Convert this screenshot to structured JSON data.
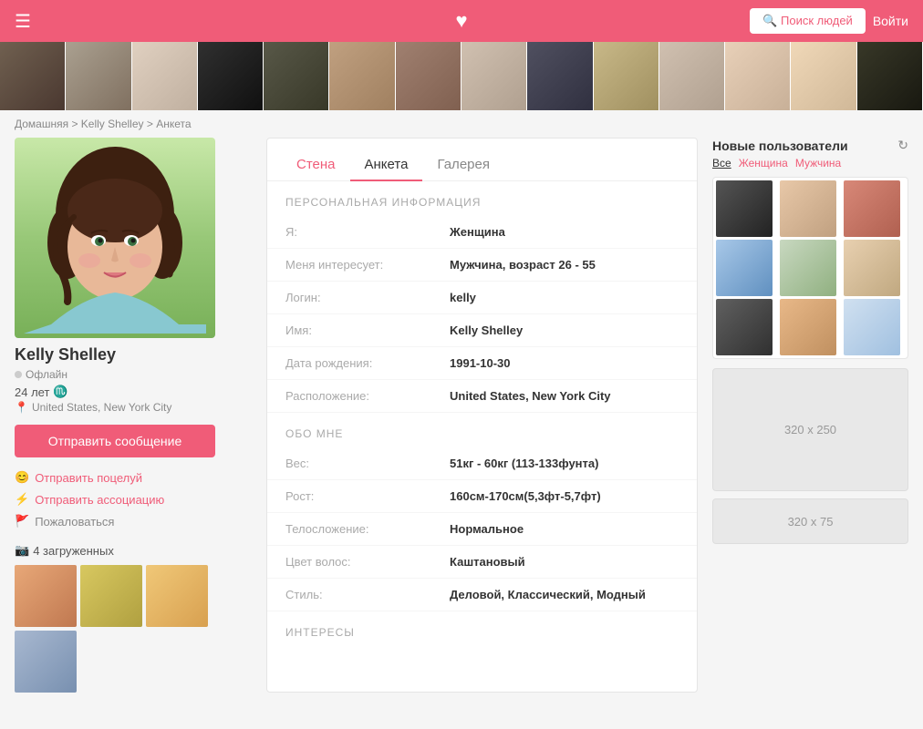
{
  "header": {
    "search_btn": "🔍 Поиск людей",
    "login_btn": "Войти",
    "heart": "♥"
  },
  "breadcrumb": {
    "home": "Домашняя",
    "name": "Kelly Shelley",
    "page": "Анкета"
  },
  "profile": {
    "name": "Kelly Shelley",
    "status": "Офлайн",
    "age": "24 лет",
    "zodiac": "♏",
    "location": "United States, New York City",
    "send_msg": "Отправить сообщение",
    "actions": [
      {
        "label": "Отправить поцелуй",
        "icon": "😊",
        "pink": true
      },
      {
        "label": "Отправить ассоциацию",
        "icon": "⚡",
        "pink": true
      },
      {
        "label": "Пожаловаться",
        "icon": "🚩",
        "pink": false
      }
    ],
    "photos_label": "4 загруженных",
    "camera_icon": "📷"
  },
  "tabs": [
    {
      "label": "Стена",
      "id": "wall",
      "active": false,
      "pink": true
    },
    {
      "label": "Анкета",
      "id": "profile",
      "active": true,
      "pink": false
    },
    {
      "label": "Галерея",
      "id": "gallery",
      "active": false,
      "pink": false
    }
  ],
  "personal_info": {
    "section_title": "ПЕРСОНАЛЬНАЯ ИНФОРМАЦИЯ",
    "fields": [
      {
        "label": "Я:",
        "value": "Женщина"
      },
      {
        "label": "Меня интересует:",
        "value": "Мужчина, возраст 26 - 55"
      },
      {
        "label": "Логин:",
        "value": "kelly"
      },
      {
        "label": "Имя:",
        "value": "Kelly Shelley"
      },
      {
        "label": "Дата рождения:",
        "value": "1991-10-30"
      },
      {
        "label": "Расположение:",
        "value": "United States, New York City"
      }
    ]
  },
  "about_me": {
    "section_title": "ОБО МНЕ",
    "fields": [
      {
        "label": "Вес:",
        "value": "51кг - 60кг (113-133фунта)"
      },
      {
        "label": "Рост:",
        "value": "160см-170см(5,3фт-5,7фт)"
      },
      {
        "label": "Телосложение:",
        "value": "Нормальное"
      },
      {
        "label": "Цвет волос:",
        "value": "Каштановый"
      },
      {
        "label": "Стиль:",
        "value": "Деловой, Классический, Модный"
      }
    ]
  },
  "interests": {
    "section_title": "ИНТЕРЕСЫ"
  },
  "sidebar": {
    "title": "Новые пользователи",
    "refresh": "↻",
    "filters": [
      {
        "label": "Все",
        "active": true
      },
      {
        "label": "Женщина",
        "active": false
      },
      {
        "label": "Мужчина",
        "active": false
      }
    ],
    "ad1": "320 x 250",
    "ad2": "320 x 75"
  }
}
